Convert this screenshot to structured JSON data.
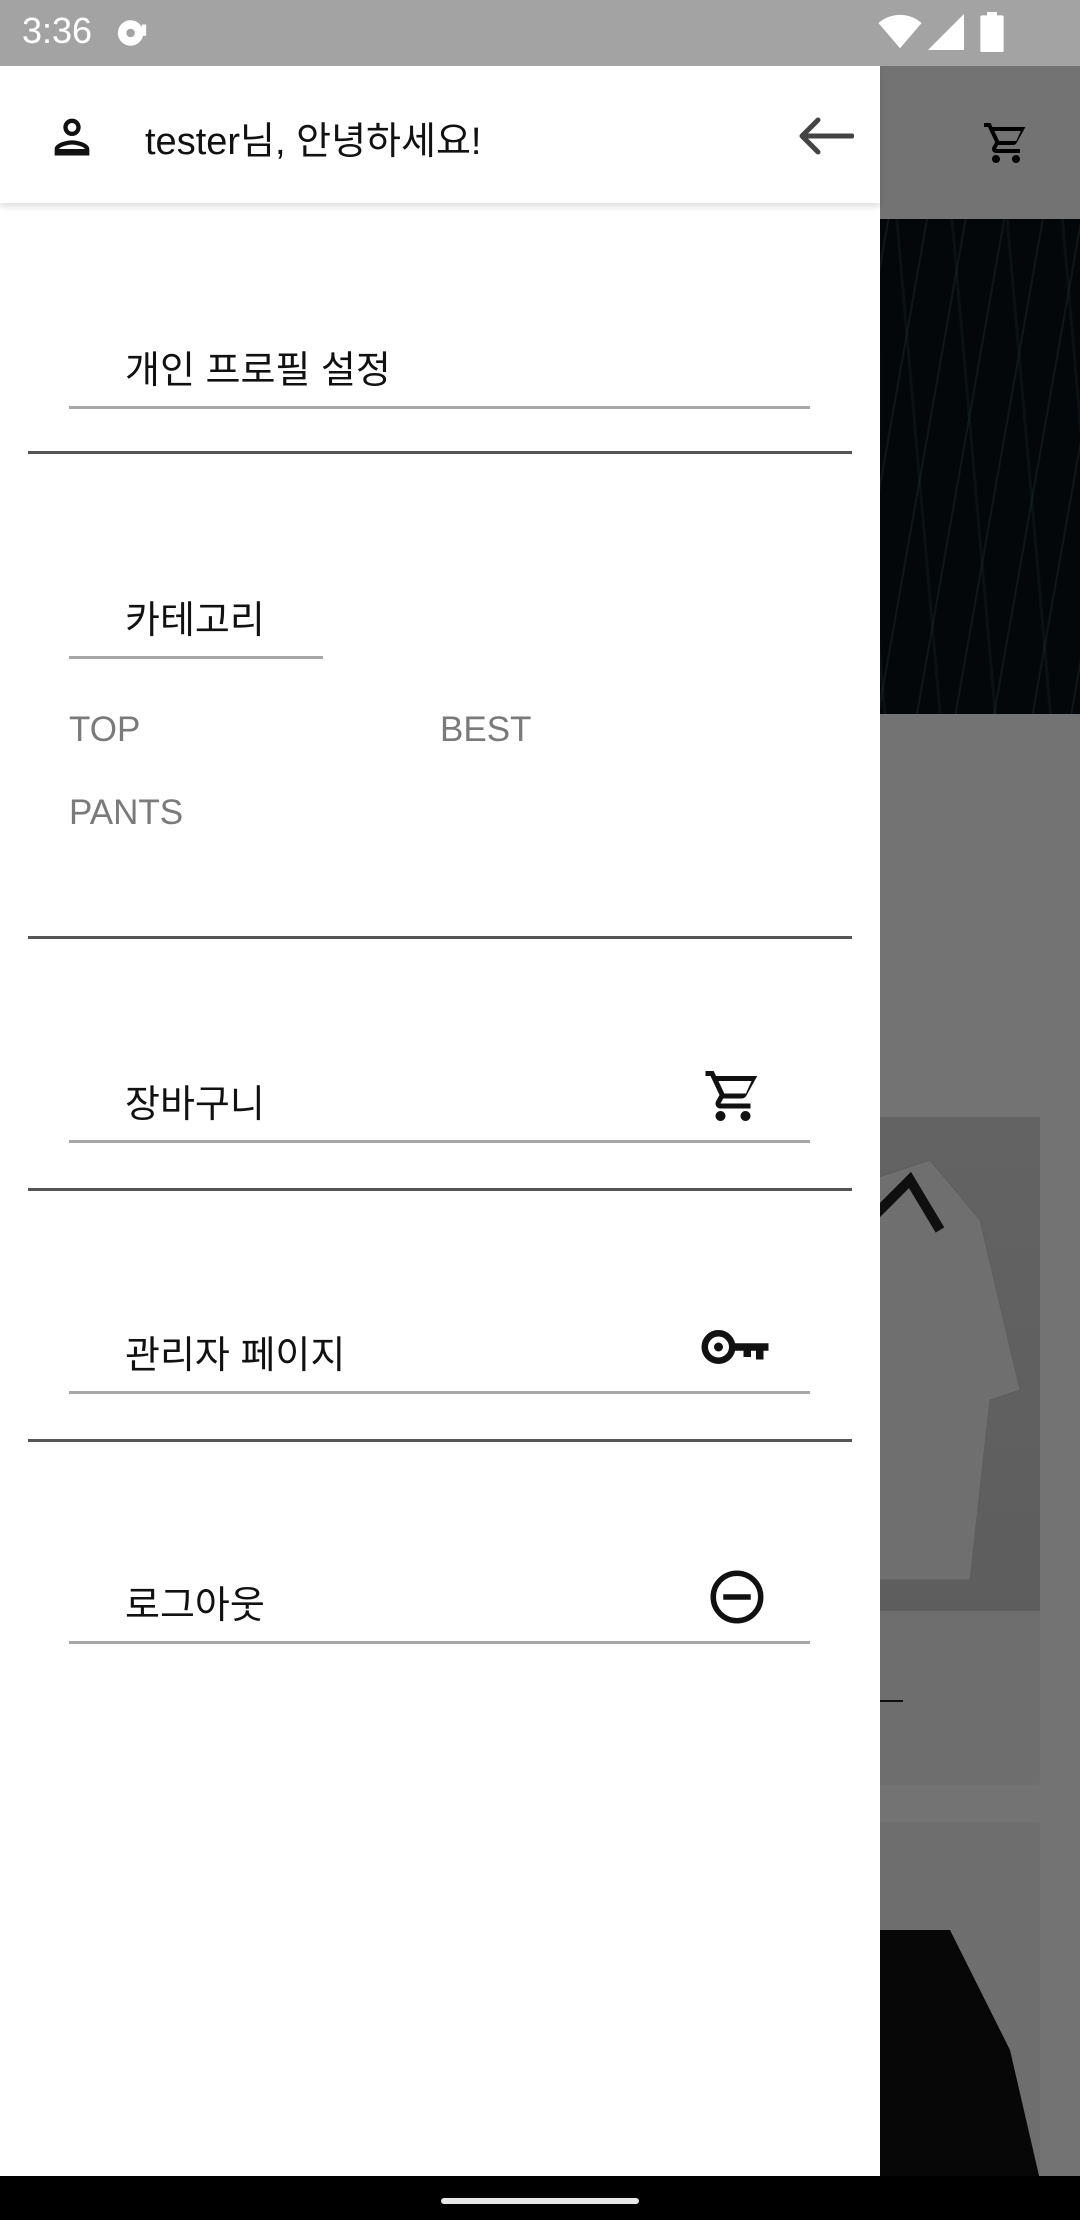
{
  "status_bar": {
    "time": "3:36",
    "icons": [
      "media-icon",
      "wifi-icon",
      "signal-icon",
      "battery-icon"
    ]
  },
  "drawer": {
    "greeting": "tester님, 안녕하세요!",
    "profile_settings_label": "개인 프로필 설정",
    "category_label": "카테고리",
    "categories": [
      "TOP",
      "BEST",
      "PANTS"
    ],
    "cart_label": "장바구니",
    "admin_label": "관리자 페이지",
    "logout_label": "로그아웃"
  },
  "background_app": {
    "header_icon": "cart-icon"
  },
  "colors": {
    "status_bar": "#a3a3a3",
    "drawer_bg": "#ffffff",
    "category_text": "#7a7a7a",
    "scrim": "#6f6f6f"
  }
}
